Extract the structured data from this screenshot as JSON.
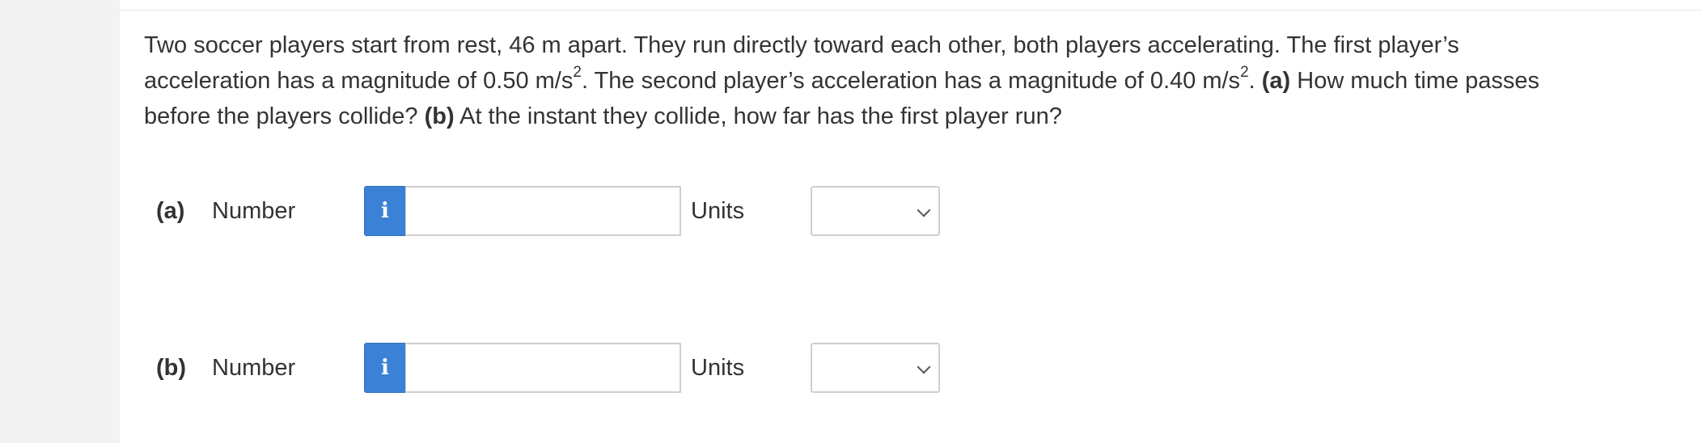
{
  "question": {
    "line1": "Two soccer players start from rest, 46 m apart. They run directly toward each other, both players accelerating. The first player’s",
    "line2_a": "acceleration has a magnitude of 0.50 m/s",
    "sup1": "2",
    "line2_b": ". The second player’s acceleration has a magnitude of 0.40 m/s",
    "sup2": "2",
    "line2_c": ". ",
    "part_a_tag": "(a)",
    "part_a_text": " How much time passes",
    "line3_a": "before the players collide? ",
    "part_b_tag": "(b)",
    "part_b_text": " At the instant they collide, how far has the first player run?"
  },
  "answers": [
    {
      "part": "(a)",
      "number_label": "Number",
      "info_icon": "i",
      "number_value": "",
      "units_label": "Units",
      "units_selected": ""
    },
    {
      "part": "(b)",
      "number_label": "Number",
      "info_icon": "i",
      "number_value": "",
      "units_label": "Units",
      "units_selected": ""
    }
  ],
  "colors": {
    "info_button": "#3b82d6",
    "text": "#333333",
    "border": "#cfcfcf"
  }
}
